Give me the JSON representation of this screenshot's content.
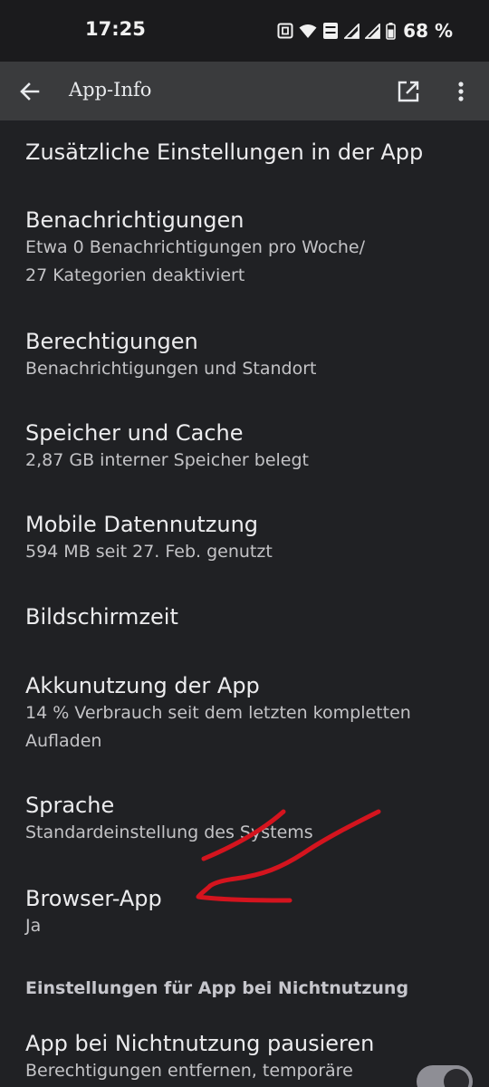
{
  "status": {
    "time": "17:25",
    "battery": "68 %"
  },
  "header": {
    "title": "App-Info"
  },
  "items": [
    {
      "title": "Zusätzliche Einstellungen in der App"
    },
    {
      "title": "Benachrichtigungen",
      "subtitle_line1": "Etwa 0 Benachrichtigungen pro Woche/",
      "subtitle_line2": "27 Kategorien deaktiviert"
    },
    {
      "title": "Berechtigungen",
      "subtitle": "Benachrichtigungen und Standort"
    },
    {
      "title": "Speicher und Cache",
      "subtitle": "2,87 GB interner Speicher belegt"
    },
    {
      "title": "Mobile Datennutzung",
      "subtitle": "594 MB seit 27. Feb. genutzt"
    },
    {
      "title": "Bildschirmzeit"
    },
    {
      "title": "Akkunutzung der App",
      "subtitle_line1": "14 % Verbrauch seit dem letzten kompletten",
      "subtitle_line2": "Aufladen"
    },
    {
      "title": "Sprache",
      "subtitle": "Standardeinstellung des Systems"
    },
    {
      "title": "Browser-App",
      "subtitle": "Ja"
    }
  ],
  "section": {
    "title": "Einstellungen für App bei Nichtnutzung",
    "pause_title": "App bei Nichtnutzung pausieren",
    "pause_subtitle": "Berechtigungen entfernen, temporäre"
  },
  "colors": {
    "background": "#202124",
    "app_bar": "#3a3b3d",
    "annotation": "#d4141e"
  },
  "icons": [
    "back-arrow-icon",
    "open-external-icon",
    "more-vert-icon",
    "nfc-icon",
    "wifi-icon",
    "volte-icon",
    "signal-icon",
    "battery-icon"
  ]
}
